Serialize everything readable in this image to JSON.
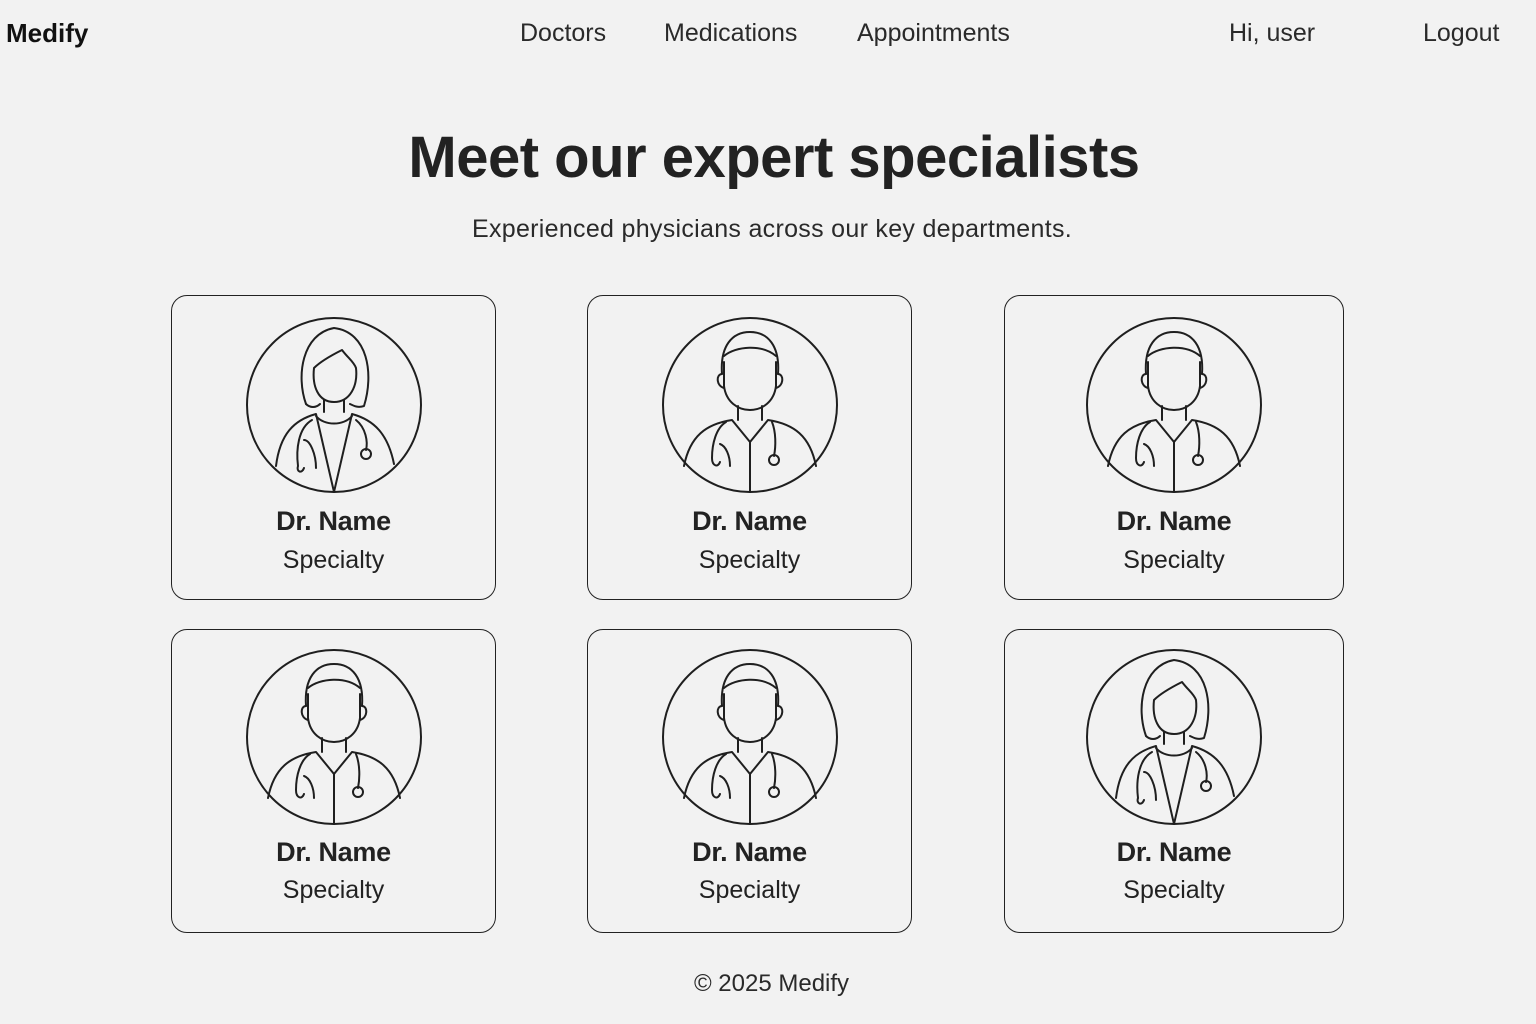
{
  "header": {
    "brand": "Medify",
    "nav": {
      "doctors": "Doctors",
      "medications": "Medications",
      "appointments": "Appointments"
    },
    "greeting": "Hi, user",
    "logout": "Logout"
  },
  "hero": {
    "title": "Meet our expert specialists",
    "subtitle": "Experienced physicians across our key departments."
  },
  "doctors": [
    {
      "name": "Dr. Name",
      "specialty": "Specialty",
      "avatar": "female-doctor-avatar-icon"
    },
    {
      "name": "Dr. Name",
      "specialty": "Specialty",
      "avatar": "male-doctor-avatar-icon"
    },
    {
      "name": "Dr. Name",
      "specialty": "Specialty",
      "avatar": "male-doctor-avatar-icon"
    },
    {
      "name": "Dr. Name",
      "specialty": "Specialty",
      "avatar": "male-doctor-avatar-icon"
    },
    {
      "name": "Dr. Name",
      "specialty": "Specialty",
      "avatar": "male-doctor-avatar-icon"
    },
    {
      "name": "Dr. Name",
      "specialty": "Specialty",
      "avatar": "female-doctor-avatar-icon"
    }
  ],
  "footer": {
    "copyright": "© 2025 Medify"
  },
  "colors": {
    "background": "#f2f2f2",
    "text": "#1f1f1f",
    "border": "#222222"
  }
}
